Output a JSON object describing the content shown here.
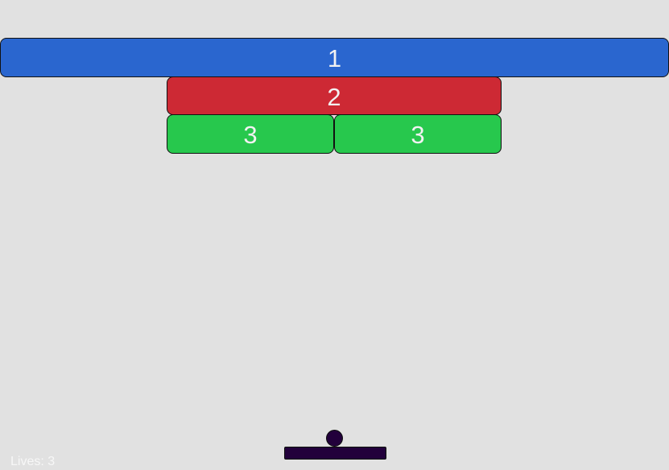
{
  "colors": {
    "background": "#e1e1e1",
    "brick_blue": "#2a66cf",
    "brick_red": "#cd2934",
    "brick_green": "#27c84d",
    "ball": "#22003b",
    "paddle": "#22003b",
    "text": "#f2f2f2"
  },
  "bricks": [
    {
      "label": "1",
      "color_key": "brick_blue"
    },
    {
      "label": "2",
      "color_key": "brick_red"
    },
    {
      "label": "3",
      "color_key": "brick_green"
    },
    {
      "label": "3",
      "color_key": "brick_green"
    }
  ],
  "hud": {
    "lives_text": "Lives: 3"
  }
}
